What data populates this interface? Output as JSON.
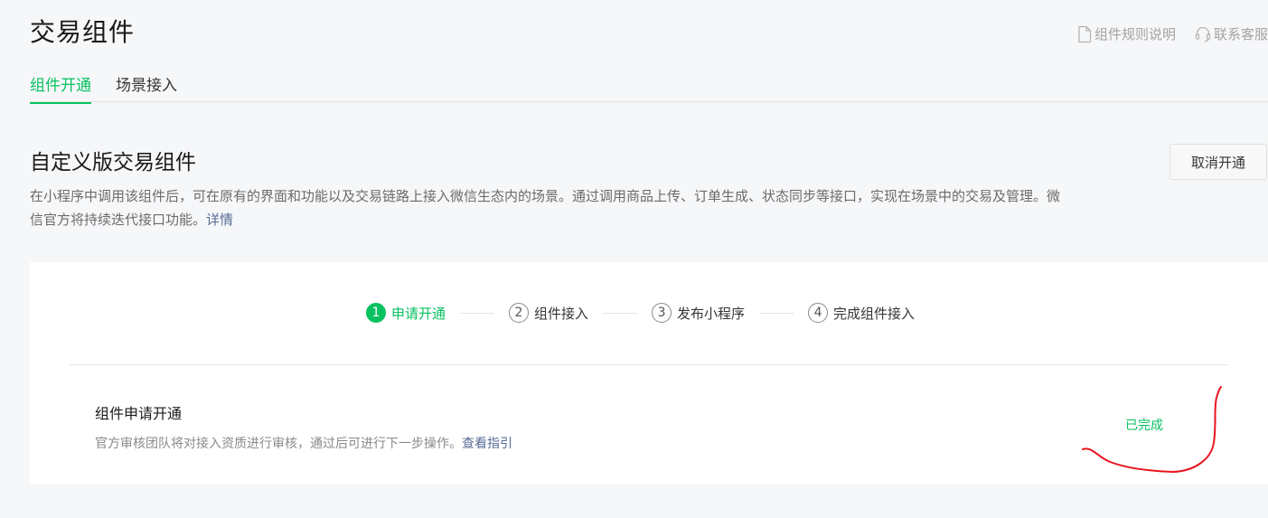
{
  "page": {
    "title": "交易组件"
  },
  "header_links": [
    {
      "icon": "document-icon",
      "label": "组件规则说明"
    },
    {
      "icon": "headset-icon",
      "label": "联系客服"
    }
  ],
  "tabs": [
    {
      "label": "组件开通",
      "active": true
    },
    {
      "label": "场景接入",
      "active": false
    }
  ],
  "section": {
    "title": "自定义版交易组件",
    "description": "在小程序中调用该组件后，可在原有的界面和功能以及交易链路上接入微信生态内的场景。通过调用商品上传、订单生成、状态同步等接口，实现在场景中的交易及管理。微信官方将持续迭代接口功能。",
    "detail_link": "详情",
    "cancel_button": "取消开通"
  },
  "steps": [
    {
      "number": "1",
      "label": "申请开通",
      "active": true
    },
    {
      "number": "2",
      "label": "组件接入",
      "active": false
    },
    {
      "number": "3",
      "label": "发布小程序",
      "active": false
    },
    {
      "number": "4",
      "label": "完成组件接入",
      "active": false
    }
  ],
  "application": {
    "title": "组件申请开通",
    "description": "官方审核团队将对接入资质进行审核，通过后可进行下一步操作。",
    "guide_link": "查看指引",
    "status": "已完成"
  },
  "colors": {
    "accent": "#07c160",
    "link": "#576b95",
    "annotation": "#e8141d"
  }
}
